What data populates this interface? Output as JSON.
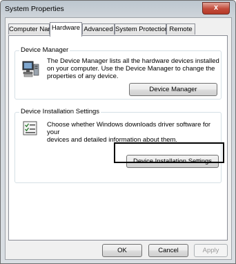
{
  "window": {
    "title": "System Properties",
    "close_glyph": "x"
  },
  "tabs": [
    {
      "label": "Computer Name",
      "active": false
    },
    {
      "label": "Hardware",
      "active": true
    },
    {
      "label": "Advanced",
      "active": false
    },
    {
      "label": "System Protection",
      "active": false
    },
    {
      "label": "Remote",
      "active": false
    }
  ],
  "device_manager": {
    "group_title": "Device Manager",
    "description_lines": [
      "The Device Manager lists all the hardware devices installed",
      "on your computer. Use the Device Manager to change the",
      "properties of any device."
    ],
    "button_label": "Device Manager",
    "icon": "computer-icon"
  },
  "device_installation": {
    "group_title": "Device Installation Settings",
    "description_lines": [
      "Choose whether Windows downloads driver software for your",
      "devices and detailed information about them."
    ],
    "button_label": "Device Installation Settings",
    "icon": "checklist-icon"
  },
  "footer": {
    "ok_label": "OK",
    "cancel_label": "Cancel",
    "apply_label": "Apply"
  },
  "colors": {
    "close_button": "#c24a39",
    "highlight_border": "#000000"
  }
}
